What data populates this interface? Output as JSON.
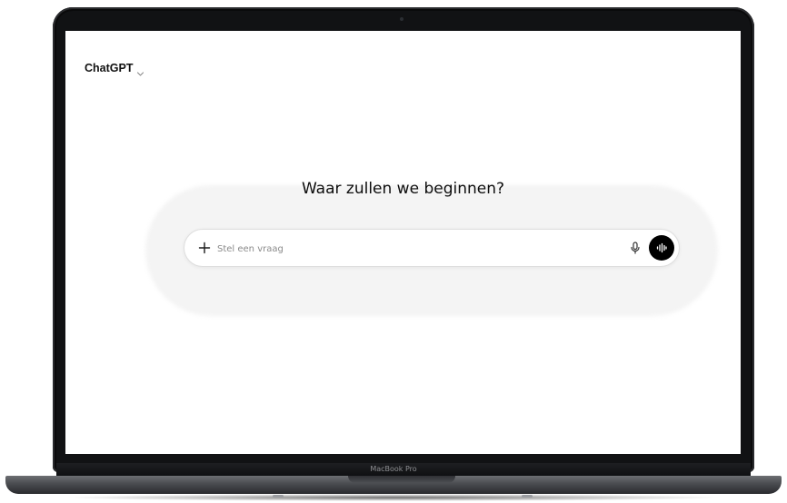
{
  "device": {
    "brand_label": "MacBook Pro"
  },
  "app": {
    "model_selector": {
      "label": "ChatGPT",
      "icon": "chevron-down-icon"
    },
    "headline": "Waar zullen we beginnen?",
    "composer": {
      "placeholder": "Stel een vraag",
      "value": "",
      "attach_icon": "plus-icon",
      "dictate_icon": "microphone-icon",
      "voice_icon": "voice-waveform-icon",
      "voice_button_color": "#000000"
    }
  }
}
